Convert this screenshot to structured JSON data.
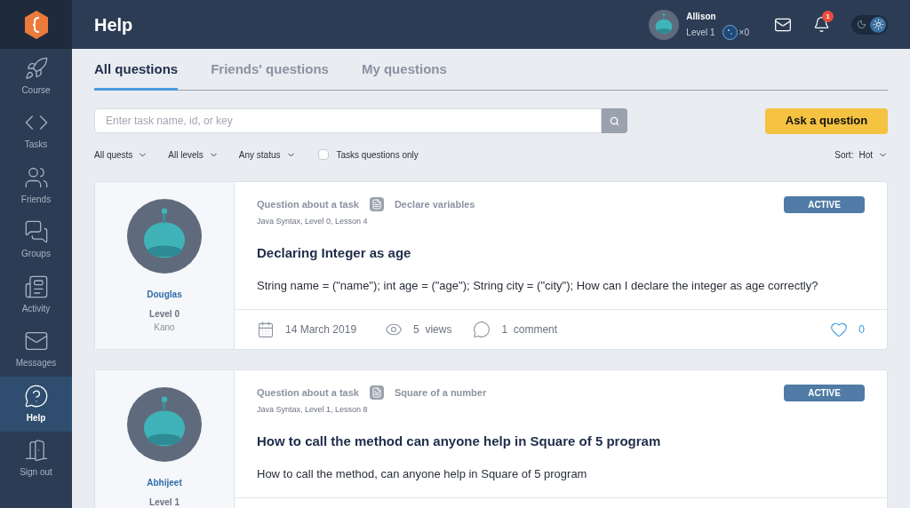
{
  "sidebar": {
    "items": [
      {
        "label": "Course",
        "selected": false
      },
      {
        "label": "Tasks",
        "selected": false
      },
      {
        "label": "Friends",
        "selected": false
      },
      {
        "label": "Groups",
        "selected": false
      },
      {
        "label": "Activity",
        "selected": false
      },
      {
        "label": "Messages",
        "selected": false
      },
      {
        "label": "Help",
        "selected": true
      },
      {
        "label": "Sign out",
        "selected": false
      }
    ]
  },
  "header": {
    "title": "Help",
    "user": {
      "name": "Allison",
      "level": "Level 1",
      "coins": "×0"
    },
    "notifications": "1",
    "theme": {
      "light": true
    }
  },
  "tabs": [
    {
      "label": "All questions",
      "selected": true
    },
    {
      "label": "Friends' questions",
      "selected": false
    },
    {
      "label": "My questions",
      "selected": false
    }
  ],
  "search": {
    "placeholder": "Enter task name, id, or key"
  },
  "ask_button": "Ask a question",
  "filters": [
    {
      "label": "All quests"
    },
    {
      "label": "All levels"
    },
    {
      "label": "Any status"
    }
  ],
  "tasks_only": {
    "label": "Tasks questions only",
    "checked": false
  },
  "sort": {
    "label": "Sort:",
    "value": "Hot"
  },
  "questions": [
    {
      "author": "Douglas",
      "level": "Level 0",
      "rank": "Kano",
      "type": "Question about a task",
      "task": "Declare variables",
      "lesson": "Java Syntax, Level 0, Lesson 4",
      "status": "ACTIVE",
      "title": "Declaring Integer as age",
      "body": "String name = (\"name\"); int age = (\"age\"); String city = (\"city\"); How can I declare the integer as age correctly?",
      "footer": {
        "date": "14 March 2019",
        "views": "5  views",
        "comments": "1  comment",
        "likes": "0"
      }
    },
    {
      "author": "Abhijeet",
      "level": "Level 1",
      "type": "Question about a task",
      "task": "Square of a number",
      "lesson": "Java Syntax, Level 1, Lesson 8",
      "status": "ACTIVE",
      "title": "How to call the method can anyone help in Square of 5 program",
      "body": "How to call the method, can anyone help in Square of 5 program"
    }
  ]
}
